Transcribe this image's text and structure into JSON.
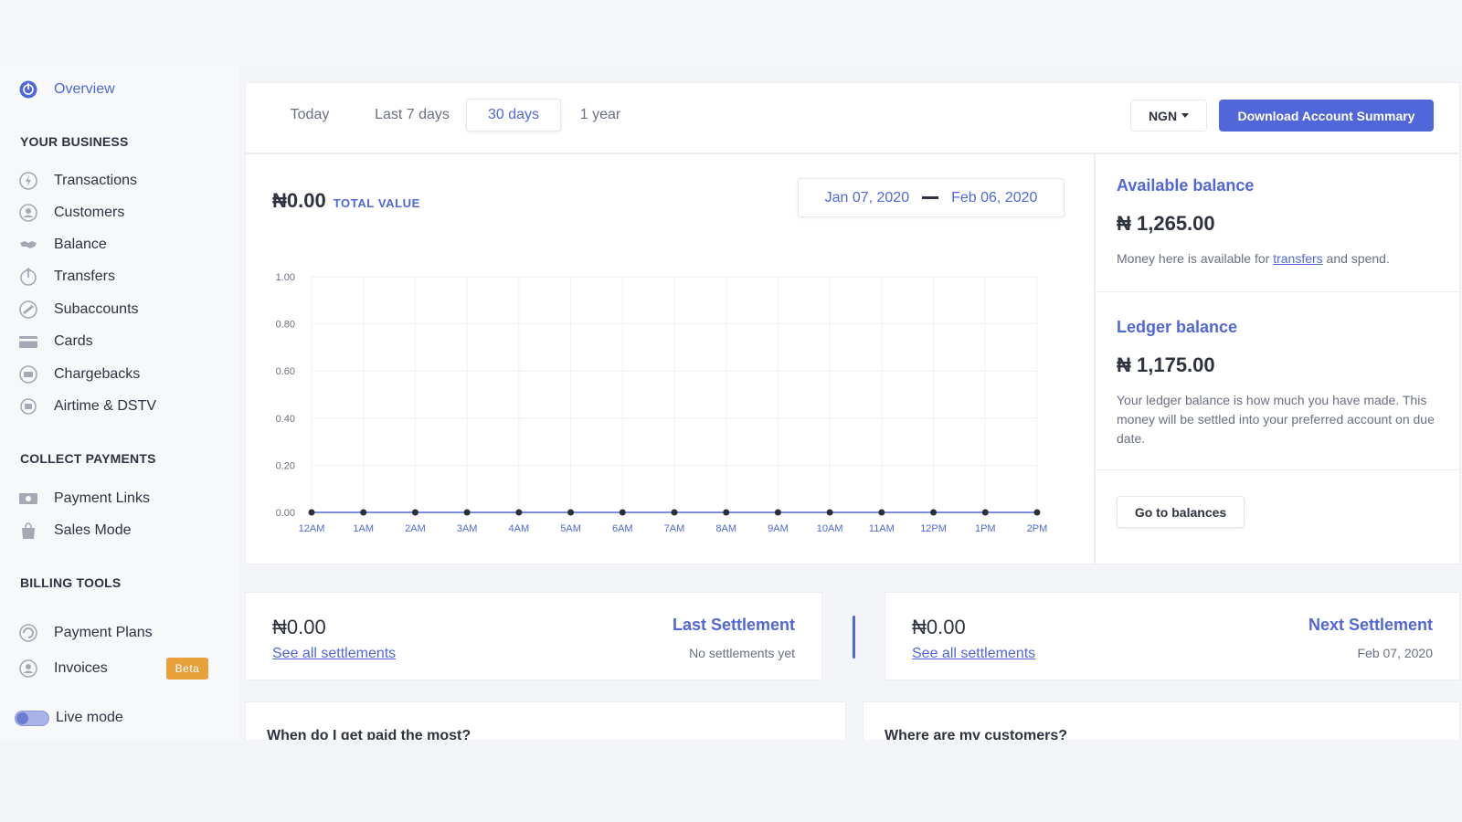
{
  "sidebar": {
    "overview": "Overview",
    "sections": [
      {
        "heading": "YOUR BUSINESS"
      },
      {
        "heading": "COLLECT PAYMENTS"
      },
      {
        "heading": "BILLING TOOLS"
      }
    ],
    "items": {
      "transactions": "Transactions",
      "customers": "Customers",
      "balance": "Balance",
      "transfers": "Transfers",
      "subaccounts": "Subaccounts",
      "cards": "Cards",
      "chargebacks": "Chargebacks",
      "airtime": "Airtime & DSTV",
      "payment_links": "Payment Links",
      "sales_mode": "Sales Mode",
      "payment_plans": "Payment Plans",
      "invoices": "Invoices"
    },
    "beta_badge": "Beta",
    "live_mode": "Live mode",
    "live_mode_on": true
  },
  "topbar": {
    "tabs": [
      "Today",
      "Last 7 days",
      "30 days",
      "1 year"
    ],
    "active_tab": "30 days",
    "currency": "NGN",
    "download_button": "Download Account Summary"
  },
  "summary": {
    "total_amount": "₦0.00",
    "total_label": "TOTAL VALUE",
    "date_from": "Jan 07, 2020",
    "date_to": "Feb 06, 2020"
  },
  "chart_data": {
    "type": "line",
    "x": [
      "12AM",
      "1AM",
      "2AM",
      "3AM",
      "4AM",
      "5AM",
      "6AM",
      "7AM",
      "8AM",
      "9AM",
      "10AM",
      "11AM",
      "12PM",
      "1PM",
      "2PM"
    ],
    "series": [
      {
        "values": [
          0,
          0,
          0,
          0,
          0,
          0,
          0,
          0,
          0,
          0,
          0,
          0,
          0,
          0,
          0
        ]
      }
    ],
    "yticks": [
      "0.00",
      "0.20",
      "0.40",
      "0.60",
      "0.80",
      "1.00"
    ],
    "ylim": [
      0,
      1
    ],
    "grid": true,
    "colors": {
      "line": "#5167d9",
      "point": "#2b2f3a"
    }
  },
  "balances": {
    "available": {
      "title": "Available balance",
      "amount": "₦ 1,265.00",
      "desc_before": "Money here is available for ",
      "desc_link": "transfers",
      "desc_after": " and spend."
    },
    "ledger": {
      "title": "Ledger balance",
      "amount": "₦ 1,175.00",
      "desc": "Your ledger balance is how much you have made. This money will be settled into your preferred account on due date."
    },
    "goto_button": "Go to balances"
  },
  "settlements": {
    "last": {
      "amount": "₦0.00",
      "link": "See all settlements",
      "title": "Last Settlement",
      "sub": "No settlements yet"
    },
    "next": {
      "amount": "₦0.00",
      "link": "See all settlements",
      "title": "Next Settlement",
      "sub": "Feb 07, 2020"
    }
  },
  "questions": {
    "paid_most": "When do I get paid the most?",
    "customers": "Where are my customers?"
  },
  "colors": {
    "accent": "#5167d9",
    "beta": "#e8a03a"
  }
}
